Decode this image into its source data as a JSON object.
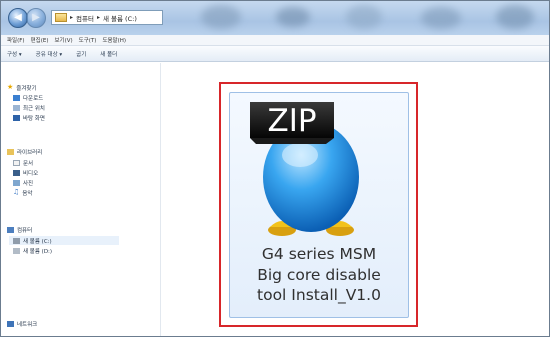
{
  "window": {
    "breadcrumb": [
      "컴퓨터",
      "새 볼륨 (C:)"
    ]
  },
  "menu": {
    "items": [
      "파일(F)",
      "편집(E)",
      "보기(V)",
      "도구(T)",
      "도움말(H)"
    ]
  },
  "toolbar": {
    "items": [
      "구성 ▾",
      "공유 대상 ▾",
      "굽기",
      "새 폴더"
    ]
  },
  "sidebar": {
    "favorites": {
      "label": "즐겨찾기",
      "icon": "star-icon",
      "items": [
        {
          "label": "다운로드",
          "icon": "download-folder-icon"
        },
        {
          "label": "최근 위치",
          "icon": "recent-places-icon"
        },
        {
          "label": "바탕 화면",
          "icon": "desktop-icon"
        }
      ]
    },
    "libraries": {
      "label": "라이브러리",
      "icon": "library-icon",
      "items": [
        {
          "label": "문서",
          "icon": "documents-icon"
        },
        {
          "label": "비디오",
          "icon": "video-icon"
        },
        {
          "label": "사진",
          "icon": "pictures-icon"
        },
        {
          "label": "음악",
          "icon": "music-icon"
        }
      ]
    },
    "computer": {
      "label": "컴퓨터",
      "icon": "computer-icon",
      "items": [
        {
          "label": "새 볼륨 (C:)",
          "icon": "drive-icon"
        },
        {
          "label": "새 볼륨 (D:)",
          "icon": "drive-icon"
        }
      ]
    },
    "network": {
      "label": "네트워크",
      "icon": "network-icon"
    }
  },
  "file": {
    "icon_badge": "ZIP",
    "name_lines": [
      "G4 series MSM",
      "Big core disable",
      "tool Install_V1.0"
    ]
  },
  "colors": {
    "highlight": "#d7262a",
    "tile_border": "#9fc0e6",
    "penguin_blue": "#1f8fe0"
  }
}
